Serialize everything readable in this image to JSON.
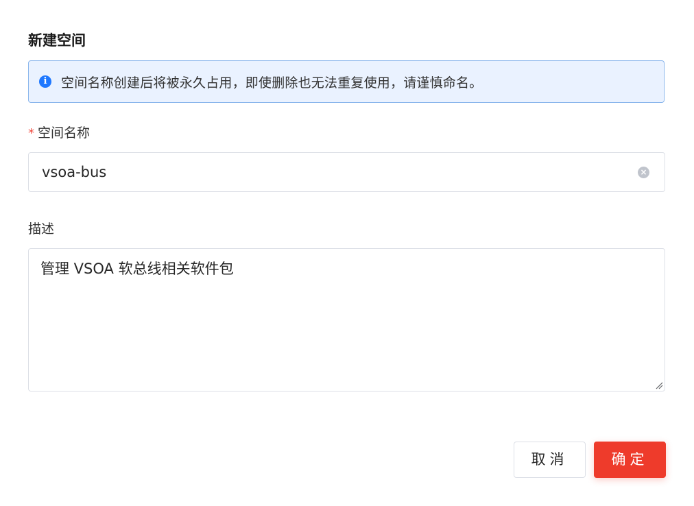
{
  "dialog": {
    "title": "新建空间",
    "alert": {
      "icon": "info-icon",
      "icon_glyph": "i",
      "text": "空间名称创建后将被永久占用，即使删除也无法重复使用，请谨慎命名。",
      "accent_color": "#1f78ff"
    },
    "name_field": {
      "required_mark": "*",
      "label": "空间名称",
      "value": "vsoa-bus",
      "clear_icon": "clear-circle-icon",
      "clear_glyph": "×"
    },
    "description_field": {
      "label": "描述",
      "value": "管理 VSOA 软总线相关软件包"
    },
    "buttons": {
      "cancel_label": "取消",
      "ok_label": "确定",
      "ok_color": "#ee3b2b"
    }
  }
}
